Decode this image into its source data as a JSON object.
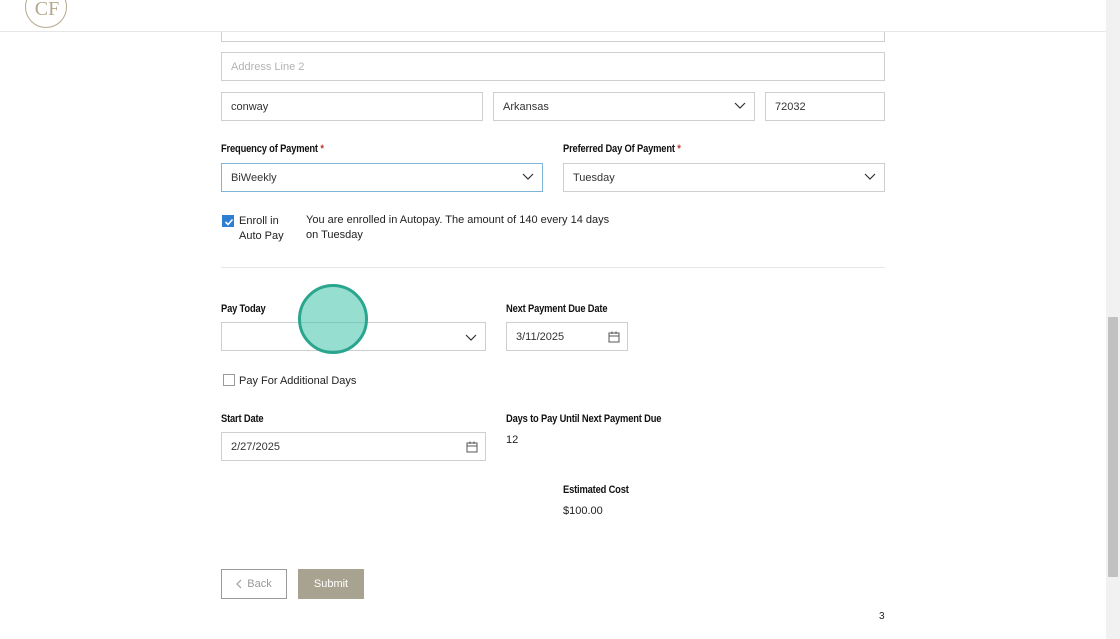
{
  "address": {
    "line2_placeholder": "Address Line 2",
    "city": "conway",
    "state": "Arkansas",
    "zip": "72032"
  },
  "payment": {
    "frequency_label": "Frequency of Payment",
    "frequency_value": "BiWeekly",
    "preferred_day_label": "Preferred Day Of Payment",
    "preferred_day_value": "Tuesday",
    "required_mark": "*"
  },
  "autopay": {
    "label_line1": "Enroll in",
    "label_line2": "Auto Pay",
    "checked": true,
    "message_line1": "You are enrolled in Autopay. The amount of 140 every 14 days",
    "message_line2": "on Tuesday"
  },
  "pay_today": {
    "label": "Pay Today",
    "value": ""
  },
  "next_due": {
    "label": "Next Payment Due Date",
    "value": "3/11/2025"
  },
  "additional_days": {
    "label": "Pay For Additional Days",
    "checked": false
  },
  "start_date": {
    "label": "Start Date",
    "value": "2/27/2025"
  },
  "days_to_pay": {
    "label": "Days to Pay Until Next Payment Due",
    "value": "12"
  },
  "estimated": {
    "label": "Estimated Cost",
    "value": "$100.00"
  },
  "buttons": {
    "back": "Back",
    "submit": "Submit"
  },
  "page_number": "3",
  "colors": {
    "accent": "#2d7fd3",
    "submit_bg": "#a8a290",
    "required": "#c0392b",
    "click_indicator": "#2aa58e"
  },
  "icons": {
    "logo": "company-logo-icon",
    "chevron": "chevron-down-icon",
    "calendar": "calendar-icon",
    "back": "chevron-left-icon"
  }
}
